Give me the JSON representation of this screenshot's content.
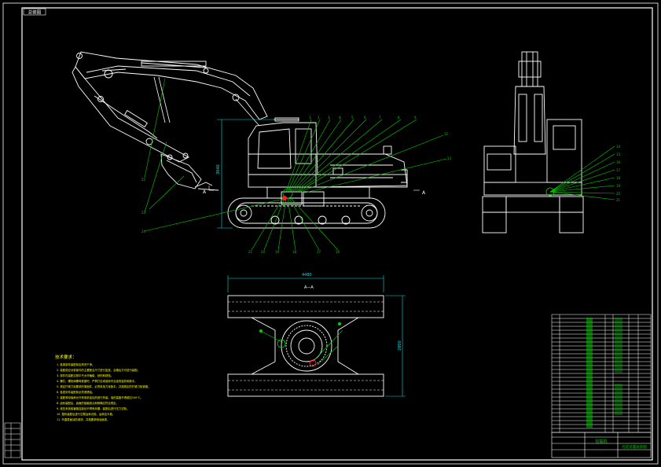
{
  "sheet": {
    "corner_tag": "总装图",
    "colors": {
      "background": "#000000",
      "line": "#ffffff",
      "leader": "#00d000",
      "dimension": "#00e0e0",
      "text_yellow": "#ffff00",
      "accent_red": "#ff2020"
    }
  },
  "views": {
    "side": {
      "section_mark_right": "A",
      "section_mark_left": "A",
      "dimension_height": "3040",
      "balloons_top": [
        "1",
        "2",
        "3",
        "4",
        "5",
        "6",
        "7",
        "8",
        "9",
        "10",
        "11"
      ],
      "balloons_right": [
        "12",
        "13"
      ],
      "balloons_bottom": [
        "21",
        "20",
        "19",
        "18",
        "17",
        "16"
      ],
      "balloons_left": [
        "22",
        "23",
        "24"
      ]
    },
    "front": {
      "balloons_right": [
        "14",
        "15",
        "16",
        "17",
        "18",
        "19",
        "20",
        "21",
        "22"
      ]
    },
    "top": {
      "section_label": "A—A",
      "dimension_length": "4480",
      "dimension_width": "2800"
    }
  },
  "notes": {
    "title": "技术要求：",
    "items": [
      "1. 各零部件装配前应清洗干净。",
      "2. 装配前应对零部件的主要配合尺寸进行复查，合格后方可进行装配。",
      "3. 零件在装配过程中不允许磕碰、划伤和锈蚀。",
      "4. 螺钉、螺栓和螺母紧固时，严禁打击或使用不合适的旋具和扳手。",
      "5. 规定拧紧力矩要求的紧固件，必须采用力矩扳手，并按规定的拧紧力矩紧固。",
      "6. 各密封件装配前必须浸透油。",
      "7. 装配滚动轴承允许采用机油加热进行热装，油的温度不得超过100℃。",
      "8. 齿轮装配后，齿面的接触斑点和侧隙应符合规定。",
      "9. 液压系统各管路连接处不得有渗漏，装配后进行压力试验。",
      "10. 整机装配后进行空载运转试验，运转应平稳。",
      "11. 外露表面涂防锈漆，并按要求喷涂面漆。"
    ]
  },
  "title_block": {
    "drawing_title": "挖掘机",
    "sub_title": "行走装置总装图"
  }
}
